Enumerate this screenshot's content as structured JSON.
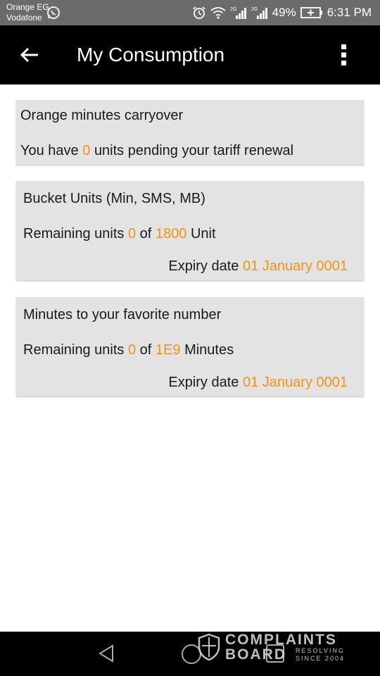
{
  "status_bar": {
    "carrier_1": "Orange EG",
    "carrier_2": "Vodafone",
    "battery": "49%",
    "time": "6:31 PM",
    "icons": [
      "whatsapp-icon",
      "alarm-icon",
      "wifi-icon",
      "signal-2g-icon",
      "signal-2g-icon",
      "battery-charging-icon"
    ]
  },
  "app_bar": {
    "title": "My Consumption",
    "icons": [
      "back-arrow-icon",
      "overflow-menu-icon"
    ]
  },
  "cards": [
    {
      "title": "Orange minutes carryover",
      "line_prefix": "You have",
      "units": "0",
      "line_suffix": "units pending your tariff renewal"
    },
    {
      "title": "Bucket Units (Min, SMS, MB)",
      "remaining_label": "Remaining units",
      "remaining": "0",
      "of_label": "of",
      "total": "1800",
      "unit": "Unit",
      "expiry_label": "Expiry date",
      "expiry_date": "01 January 0001"
    },
    {
      "title": "Minutes to your favorite number",
      "remaining_label": "Remaining units",
      "remaining": "0",
      "of_label": "of",
      "total": "1E9",
      "unit": "Minutes",
      "expiry_label": "Expiry date",
      "expiry_date": "01 January 0001"
    }
  ],
  "watermark": {
    "line1": "COMPLAINTS",
    "line2": "BOARD",
    "tag1": "RESOLVING",
    "tag2": "SINCE 2004"
  },
  "colors": {
    "accent": "#f39214",
    "card_bg": "#e3e3e3",
    "app_bar": "#000000",
    "status_bar": "#6b6b6b"
  }
}
